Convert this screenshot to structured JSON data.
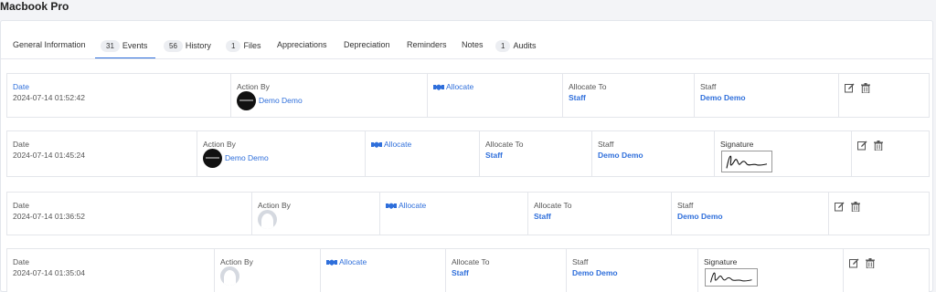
{
  "page": {
    "title": "Macbook Pro"
  },
  "tabs": [
    {
      "label": "General Information",
      "count": ""
    },
    {
      "label": "Events",
      "count": "31"
    },
    {
      "label": "History",
      "count": "56"
    },
    {
      "label": "Files",
      "count": "1"
    },
    {
      "label": "Appreciations",
      "count": ""
    },
    {
      "label": "Depreciation",
      "count": ""
    },
    {
      "label": "Reminders",
      "count": ""
    },
    {
      "label": "Notes",
      "count": ""
    },
    {
      "label": "Audits",
      "count": "1"
    }
  ],
  "labels": {
    "date": "Date",
    "action_by": "Action By",
    "allocate_to": "Allocate To",
    "staff": "Staff",
    "signature": "Signature"
  },
  "events": [
    {
      "date": "2024-07-14 01:52:42",
      "action_by": "Demo Demo",
      "action": "Allocate",
      "allocate_to": "Staff",
      "staff": "Demo Demo",
      "has_signature": false
    },
    {
      "date": "2024-07-14 01:45:24",
      "action_by": "Demo Demo",
      "action": "Allocate",
      "allocate_to": "Staff",
      "staff": "Demo Demo",
      "has_signature": true
    },
    {
      "date": "2024-07-14 01:36:52",
      "action_by": "",
      "action": "Allocate",
      "allocate_to": "Staff",
      "staff": "Demo Demo",
      "has_signature": false
    },
    {
      "date": "2024-07-14 01:35:04",
      "action_by": "",
      "action": "Allocate",
      "allocate_to": "Staff",
      "staff": "Demo Demo",
      "has_signature": true
    }
  ],
  "icons": {
    "allocate": "handshake-icon",
    "edit": "edit-icon",
    "delete": "trash-icon"
  },
  "colors": {
    "accent": "#2f6fdb"
  }
}
